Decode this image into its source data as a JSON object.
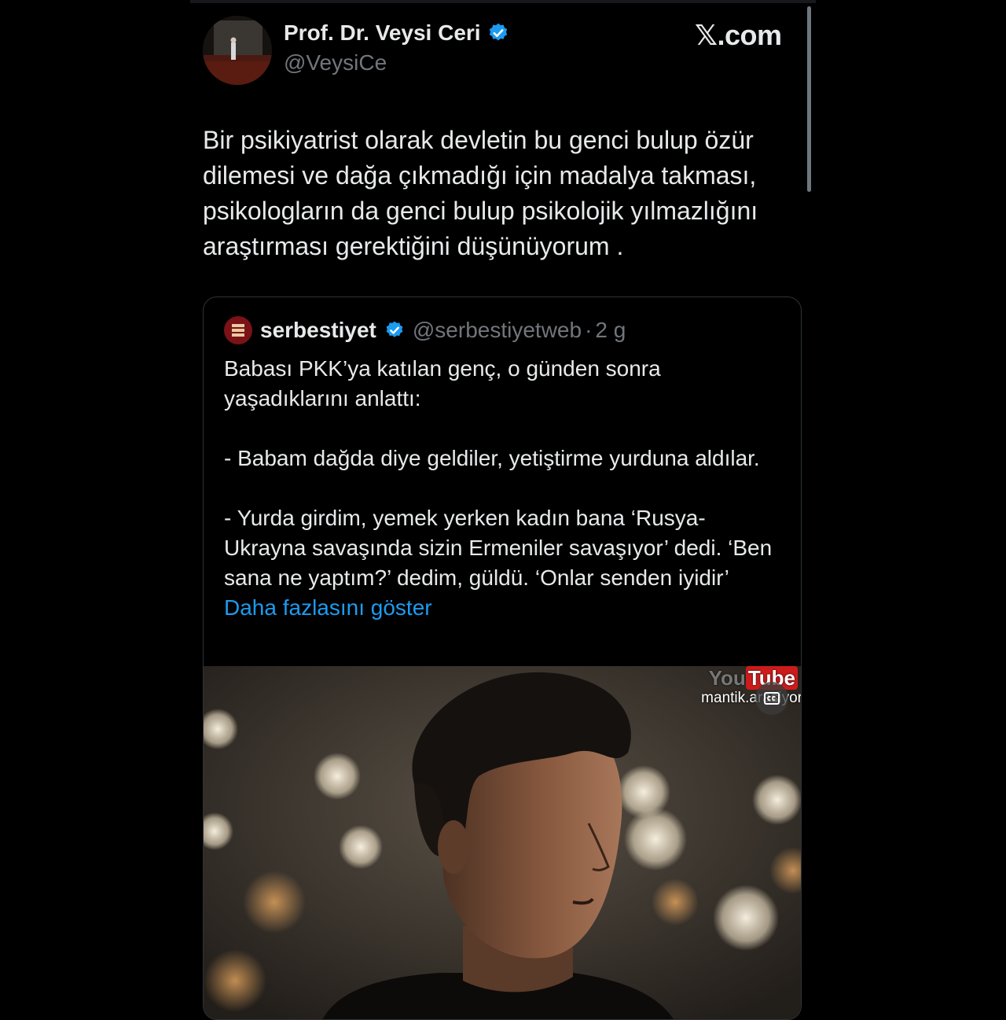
{
  "author": {
    "name": "Prof. Dr. Veysi Ceri",
    "handle": "@VeysiCe",
    "verified": true
  },
  "brand": "𝕏.com",
  "tweet": {
    "text": "Bir psikiyatrist olarak devletin bu genci bulup özür dilemesi ve dağa çıkmadığı için madalya takması, psikologların da genci bulup psikolojik yılmazlığını araştırması gerektiğini düşünüyorum ."
  },
  "quote": {
    "name": "serbestiyet",
    "verified": true,
    "handle": "@serbestiyetweb",
    "separator": "·",
    "time": "2 g",
    "text": "Babası PKK’ya katılan genç, o günden sonra yaşadıklarını anlattı:\n\n- Babam dağda diye geldiler, yetiştirme yurduna aldılar.\n\n- Yurda girdim, yemek yerken kadın bana ‘Rusya-Ukrayna savaşında sizin Ermeniler savaşıyor’ dedi. ‘Ben sana ne yaptım?’ dedim, güldü. ‘Onlar senden iyidir’ ",
    "show_more": "Daha fazlasını göster",
    "media": {
      "watermark_you": "You",
      "watermark_tube": "Tube",
      "channel": "mantik.arasiyor"
    }
  },
  "colors": {
    "background": "#000000",
    "text": "#e7e9ea",
    "muted": "#71767b",
    "link": "#1d9bf0",
    "verified": "#1d9bf0",
    "border": "#2f3336"
  },
  "icons": [
    "verified-badge-icon",
    "captions-icon"
  ]
}
